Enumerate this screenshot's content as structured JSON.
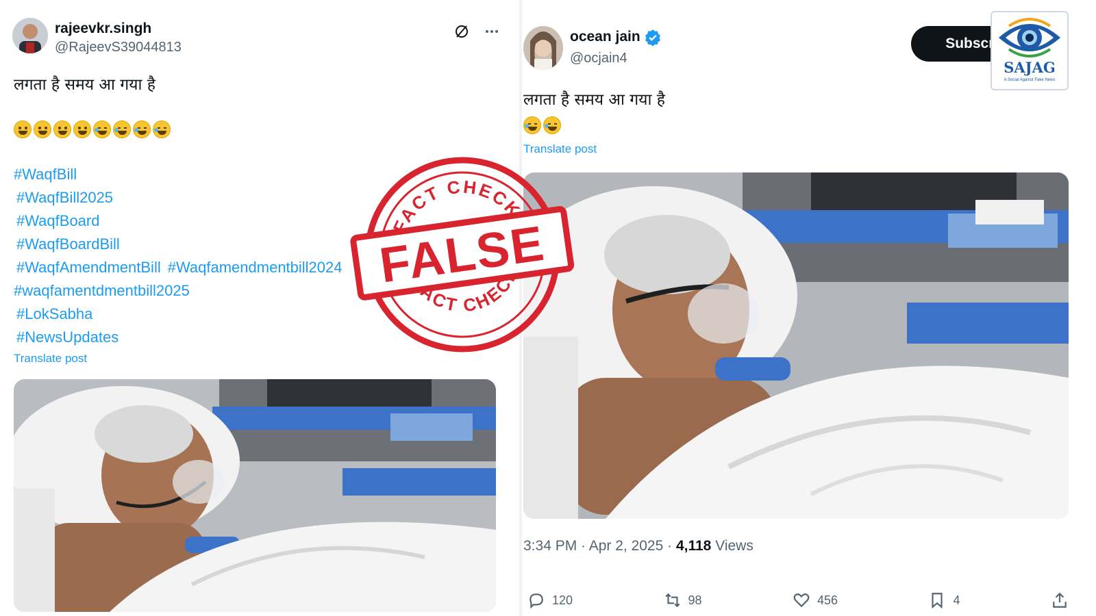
{
  "left_post": {
    "display_name": "rajeevkr.singh",
    "handle": "@RajeevS39044813",
    "text": "लगता है समय आ गया है",
    "emojis": [
      "grin",
      "grin",
      "grin",
      "grin",
      "laugh",
      "laugh",
      "laugh",
      "laugh"
    ],
    "hashtags_col": [
      "#WaqfBill",
      "#WaqfBill2025",
      "#WaqfBoard",
      "#WaqfBoardBill"
    ],
    "hashtags_row": [
      "#WaqfAmendmentBill",
      "#Waqfamendmentbill2024"
    ],
    "hashtags_col2": [
      "#waqfamentdmentbill2025",
      "#LokSabha",
      "#NewsUpdates"
    ],
    "translate_label": "Translate post",
    "menu_icon": "more-icon",
    "grok_icon": "grok-icon"
  },
  "right_post": {
    "display_name": "ocean jain",
    "handle": "@ocjain4",
    "verified_icon": "verified-badge-icon",
    "text": "लगता है समय आ गया है",
    "emojis": [
      "laugh",
      "laugh"
    ],
    "translate_label": "Translate post",
    "subscribe_label": "Subscribe",
    "time": "3:34 PM · Apr 2, 2025 · ",
    "views_count": "4,118",
    "views_label": " Views",
    "actions": [
      {
        "icon": "reply-icon",
        "count": "120"
      },
      {
        "icon": "repost-icon",
        "count": "98"
      },
      {
        "icon": "like-icon",
        "count": "456"
      },
      {
        "icon": "bookmark-icon",
        "count": "4"
      },
      {
        "icon": "share-icon",
        "count": ""
      }
    ]
  },
  "logo": {
    "name": "SAJAG",
    "tagline": "A Social Against Fake News"
  },
  "stamp": {
    "top_text": "FACT CHECK",
    "main_text": "FALSE",
    "bottom_text": "FACT CHECK",
    "color": "#d8242f"
  },
  "colors": {
    "link": "#1d9bf0",
    "muted": "#536471",
    "bed_blue": "#3c72c8"
  }
}
